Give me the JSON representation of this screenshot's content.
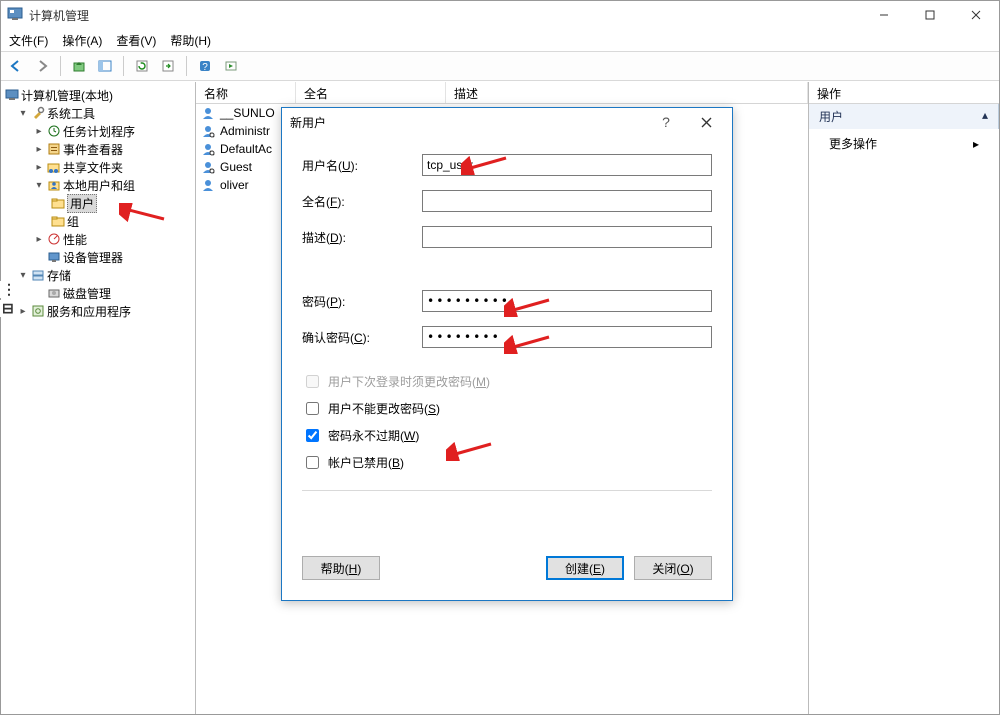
{
  "window": {
    "title": "计算机管理"
  },
  "menu": {
    "file": "文件(F)",
    "action": "操作(A)",
    "view": "查看(V)",
    "help": "帮助(H)"
  },
  "tree": {
    "root": "计算机管理(本地)",
    "system_tools": "系统工具",
    "task_scheduler": "任务计划程序",
    "event_viewer": "事件查看器",
    "shared_folders": "共享文件夹",
    "local_users_groups": "本地用户和组",
    "users": "用户",
    "groups": "组",
    "performance": "性能",
    "device_manager": "设备管理器",
    "storage": "存储",
    "disk_mgmt": "磁盘管理",
    "services_apps": "服务和应用程序"
  },
  "list": {
    "col_name": "名称",
    "col_full": "全名",
    "col_desc": "描述",
    "rows": [
      {
        "name": "__SUNLO"
      },
      {
        "name": "Administr"
      },
      {
        "name": "DefaultAc"
      },
      {
        "name": "Guest"
      },
      {
        "name": "oliver"
      }
    ]
  },
  "actions": {
    "header": "操作",
    "section": "用户",
    "more": "更多操作"
  },
  "dialog": {
    "title": "新用户",
    "username_label": "用户名(U):",
    "username_value": "tcp_user",
    "fullname_label": "全名(F):",
    "fullname_value": "",
    "desc_label": "描述(D):",
    "desc_value": "",
    "password_label": "密码(P):",
    "password_value": "•••••••••",
    "confirm_label": "确认密码(C):",
    "confirm_value": "••••••••",
    "chk_must_change": "用户下次登录时须更改密码(M)",
    "chk_cannot_change": "用户不能更改密码(S)",
    "chk_never_expire": "密码永不过期(W)",
    "chk_disabled": "帐户已禁用(B)",
    "btn_help": "帮助(H)",
    "btn_create": "创建(E)",
    "btn_close": "关闭(O)"
  }
}
